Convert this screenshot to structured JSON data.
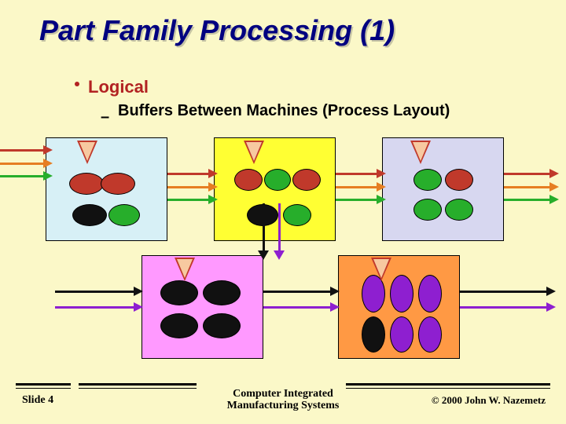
{
  "title": "Part Family Processing (1)",
  "bullet1": "Logical",
  "bullet2": "Buffers Between Machines (Process Layout)",
  "footer": {
    "slide": "Slide  4",
    "center1": "Computer Integrated",
    "center2": "Manufacturing Systems",
    "copyright": "© 2000  John W. Nazemetz"
  },
  "colors": {
    "red": "#c0392b",
    "green": "#27ae2b",
    "dark": "#111111",
    "purple": "#8e1fd0",
    "orange": "#e67e22",
    "triFill": "#f7c9a0",
    "triBorder": "#c0392b"
  }
}
